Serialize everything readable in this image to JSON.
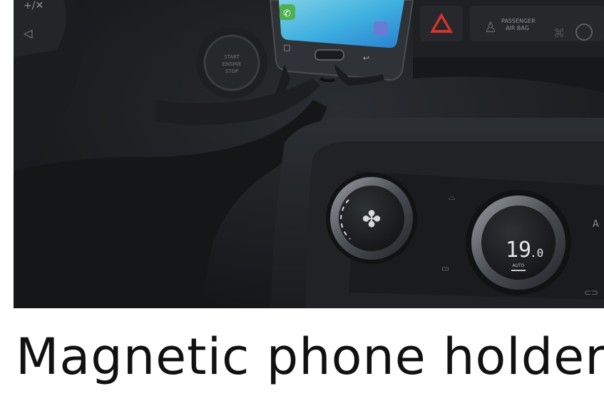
{
  "caption": "Magnetic phone holder",
  "photo": {
    "panel_labels": {
      "start_stop": [
        "START",
        "ENGINE",
        "STOP"
      ],
      "airbag": [
        "PASSENGER",
        "AIR BAG"
      ],
      "temperature_main": "19",
      "temperature_decimal": ".0",
      "auto": "AUTO",
      "side_label": "A"
    }
  }
}
